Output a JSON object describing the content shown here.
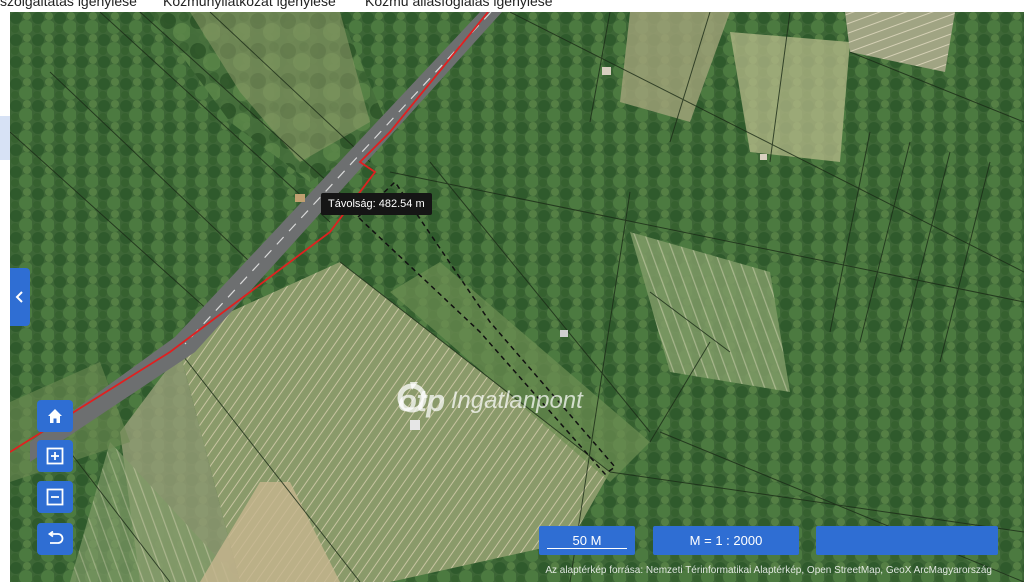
{
  "topbar": {
    "tabs": [
      {
        "label": "szolgáltatás igénylése"
      },
      {
        "label": "Közműnyilatkozat igénylése"
      },
      {
        "label": "Közmű állásfoglalás igénylése"
      }
    ]
  },
  "map": {
    "type": "satellite-cadastral",
    "measure_tooltip": "Távolság: 482.54 m",
    "watermark": {
      "logo": "otp",
      "text": "Ingatlanpont"
    },
    "attribution": "Az alaptérkép forrása: Nemzeti Térinformatikai Alaptérkép, Open StreetMap, GeoX ArcMagyarország"
  },
  "controls": {
    "home_icon": "home-icon",
    "zoom_icon": "zoom-in-icon",
    "minus_icon": "zoom-out-icon",
    "back_icon": "undo-icon",
    "sidebar_icon": "chevron-left-icon"
  },
  "scale": {
    "bar_label": "50 M",
    "ratio_label": "M = 1 : 2000",
    "extra_value": ""
  },
  "colors": {
    "accent": "#2f6ed3",
    "road_line": "#e02020",
    "measure_line": "#111111",
    "vegetation": "#3f6a3a"
  }
}
